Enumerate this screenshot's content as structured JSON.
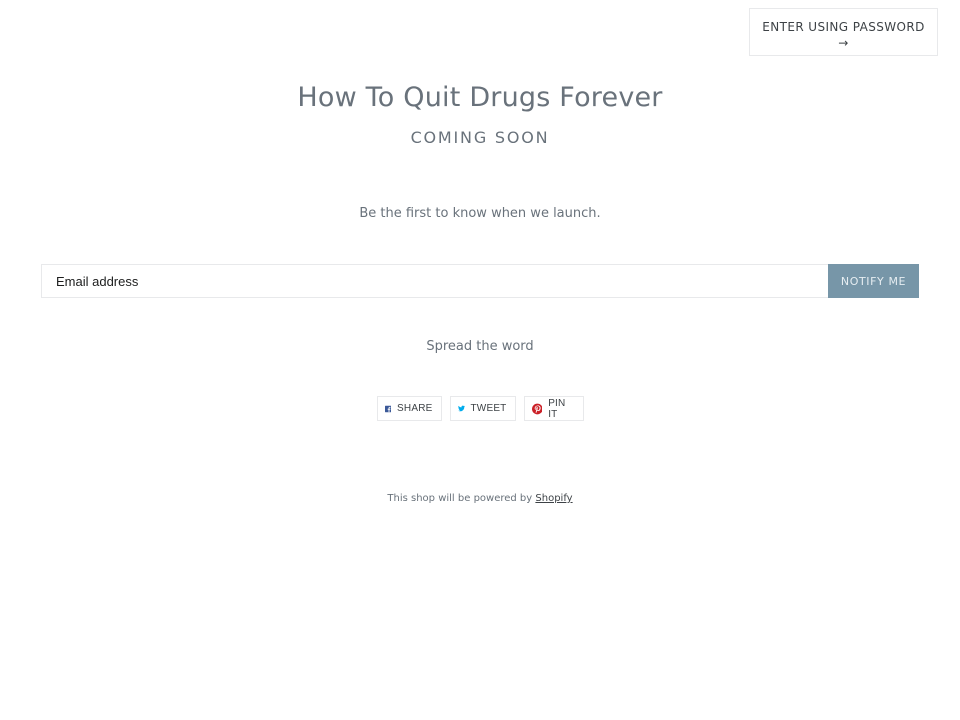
{
  "header": {
    "password_button_label": "ENTER USING PASSWORD",
    "password_button_arrow": "→"
  },
  "main": {
    "title": "How To Quit Drugs Forever",
    "subtitle": "COMING SOON",
    "tagline": "Be the first to know when we launch.",
    "email_placeholder": "Email address",
    "email_value": "",
    "notify_label": "NOTIFY ME"
  },
  "share": {
    "heading": "Spread the word",
    "buttons": [
      {
        "label": "SHARE",
        "icon": "facebook-icon",
        "color": "#3b5998"
      },
      {
        "label": "TWEET",
        "icon": "twitter-icon",
        "color": "#00aced"
      },
      {
        "label": "PIN IT",
        "icon": "pinterest-icon",
        "color": "#cb2027"
      }
    ]
  },
  "footer": {
    "powered_text": "This shop will be powered by",
    "powered_link": "Shopify"
  },
  "colors": {
    "accent": "#7796a8",
    "text": "#69727b",
    "border": "#e8e9eb"
  }
}
